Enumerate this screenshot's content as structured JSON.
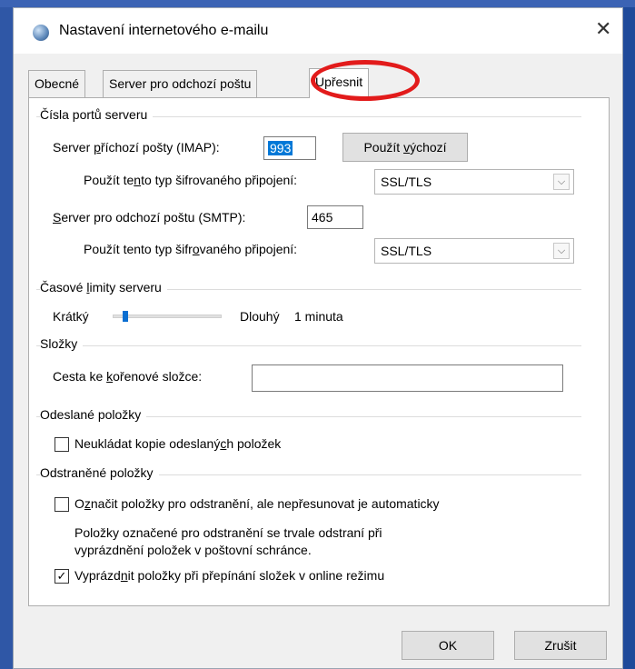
{
  "window": {
    "title": "Nastavení internetového e-mailu",
    "icon": "globe-mail-icon"
  },
  "tabs": [
    {
      "label": "Obecné",
      "active": false
    },
    {
      "label": "Server pro odchozí poštu",
      "active": false
    },
    {
      "label": "Upřesnit",
      "active": true
    }
  ],
  "ports": {
    "group_title": "Čísla portů serveru",
    "incoming_label_pre": "Server ",
    "incoming_label_u": "p",
    "incoming_label_post": "říchozí pošty (IMAP):",
    "incoming_value": "993",
    "use_default_pre": "Použít ",
    "use_default_u": "v",
    "use_default_post": "ýchozí",
    "enc1_label_pre": "Použít te",
    "enc1_label_u": "n",
    "enc1_label_post": "to typ šifrovaného připojení:",
    "enc1_value": "SSL/TLS",
    "outgoing_label_pre": "",
    "outgoing_label_u": "S",
    "outgoing_label_post": "erver pro odchozí poštu (SMTP):",
    "outgoing_value": "465",
    "enc2_label_pre": "Použít tento typ šifr",
    "enc2_label_u": "o",
    "enc2_label_post": "vaného připojení:",
    "enc2_value": "SSL/TLS"
  },
  "timeouts": {
    "group_title_pre": "Časové ",
    "group_title_u": "l",
    "group_title_post": "imity serveru",
    "short_label": "Krátký",
    "long_label": "Dlouhý",
    "value_text": "1 minuta",
    "slider_level": 0.1
  },
  "folders": {
    "group_title": "Složky",
    "root_label_pre": "Cesta ke ",
    "root_label_u": "k",
    "root_label_post": "ořenové složce:",
    "root_value": ""
  },
  "sent": {
    "group_title": "Odeslané položky",
    "no_copy_label_pre": "Neukládat kopie odeslaný",
    "no_copy_label_u": "c",
    "no_copy_label_post": "h položek",
    "no_copy_checked": false
  },
  "deleted": {
    "group_title": "Odstraněné položky",
    "mark_label_pre": "O",
    "mark_label_u": "z",
    "mark_label_post": "načit položky pro odstranění, ale nepřesunovat je automaticky",
    "mark_checked": false,
    "note_line1": "Položky označené pro odstranění se trvale odstraní při",
    "note_line2": "vyprázdnění položek v poštovní schránce.",
    "purge_label_pre": "Vyprázd",
    "purge_label_u": "n",
    "purge_label_post": "it položky při přepínání složek v online režimu",
    "purge_checked": true,
    "check_mark": "✓"
  },
  "footer": {
    "ok_label": "OK",
    "cancel_label": "Zrušit"
  },
  "colors": {
    "highlight": "#e21b1b",
    "selection": "#0078d7",
    "frame": "#2f57a6"
  }
}
